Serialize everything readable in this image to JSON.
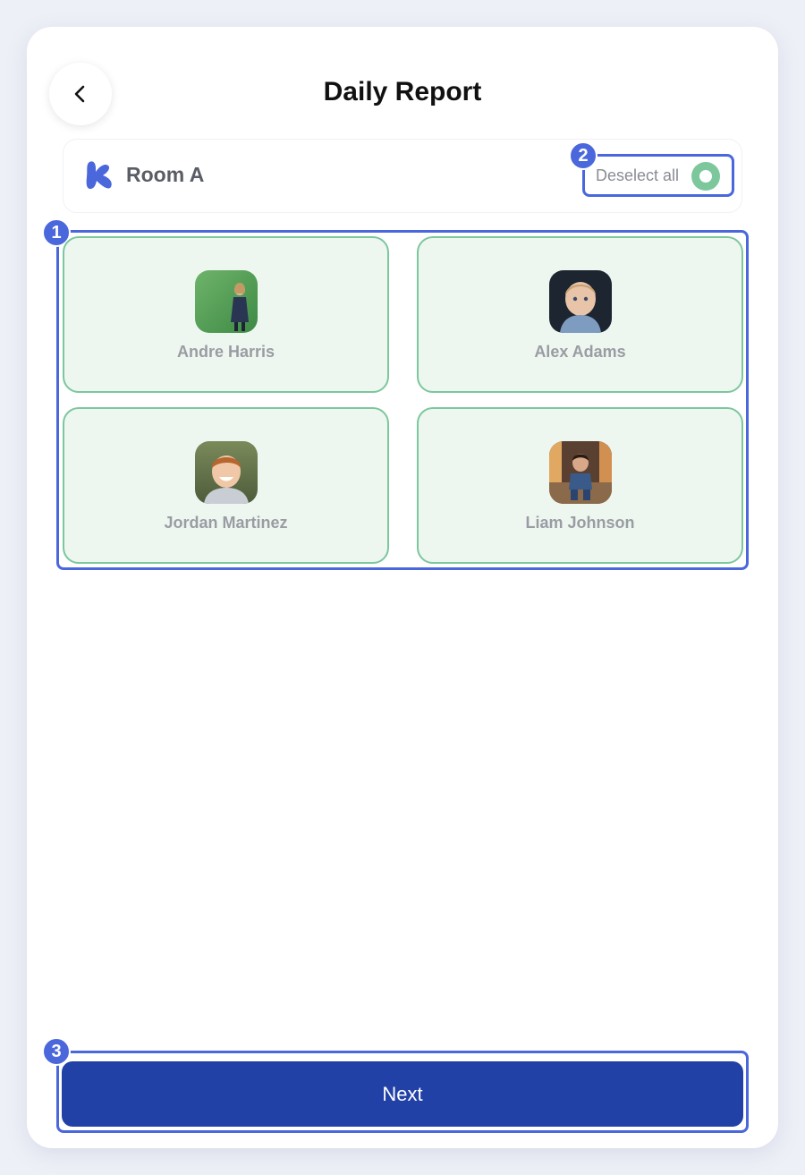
{
  "header": {
    "title": "Daily Report",
    "back_icon": "chevron-left-icon"
  },
  "room": {
    "name": "Room A",
    "icon": "room-logo-icon",
    "deselect_label": "Deselect all"
  },
  "children": [
    {
      "name": "Andre Harris",
      "photo": "child-photo-green-background"
    },
    {
      "name": "Alex Adams",
      "photo": "child-photo-dark-background"
    },
    {
      "name": "Jordan Martinez",
      "photo": "child-photo-outdoor"
    },
    {
      "name": "Liam Johnson",
      "photo": "child-photo-porch"
    }
  ],
  "annotations": [
    "1",
    "2",
    "3"
  ],
  "footer": {
    "next_label": "Next"
  },
  "colors": {
    "primary": "#2241a6",
    "annotation": "#4a67dc",
    "selected_fill": "#edf7f0",
    "selected_border": "#7cc79c"
  }
}
